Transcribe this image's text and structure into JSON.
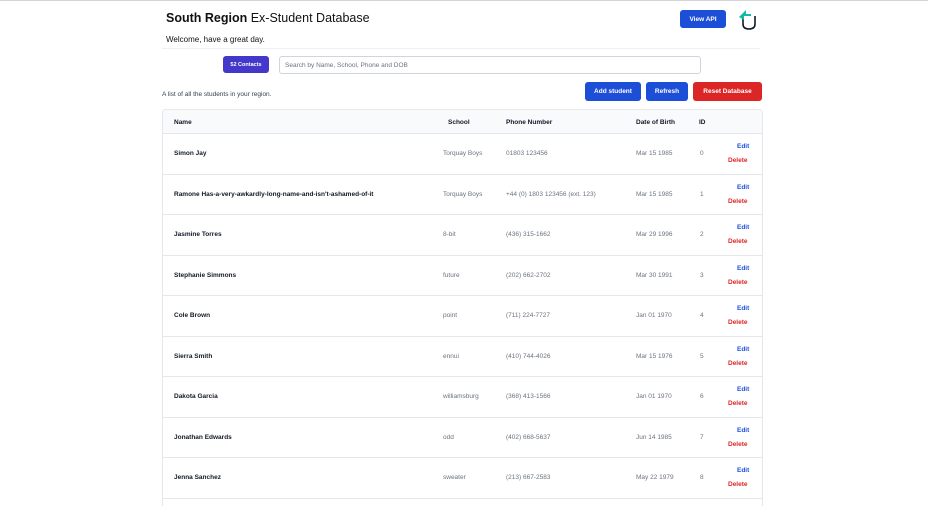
{
  "header": {
    "title_bold": "South Region",
    "title_rest": " Ex-Student Database",
    "welcome": "Welcome, have a great day.",
    "api_button": "View API",
    "logo_icon": "shield-upload-icon"
  },
  "toolbar": {
    "contacts_count": "52 Contacts",
    "search_placeholder": "Search by Name, School, Phone and DOB",
    "search_value": "",
    "caption": "A list of all the students in your region.",
    "add_label": "Add student",
    "refresh_label": "Refresh",
    "reset_label": "Reset Database"
  },
  "colors": {
    "primary": "#1d4ed8",
    "badge": "#4338ca",
    "danger": "#dc2626"
  },
  "table": {
    "columns": [
      "Name",
      "School",
      "Phone Number",
      "Date of Birth",
      "ID"
    ],
    "edit_label": "Edit",
    "delete_label": "Delete",
    "rows": [
      {
        "name": "Simon Jay",
        "school": "Torquay Boys",
        "phone": "01803 123456",
        "dob": "Mar 15 1985",
        "id": "0"
      },
      {
        "name": "Ramone Has-a-very-awkardly-long-name-and-isn't-ashamed-of-it",
        "school": "Torquay Boys",
        "phone": "+44 (0) 1803 123456 (ext. 123)",
        "dob": "Mar 15 1985",
        "id": "1"
      },
      {
        "name": "Jasmine Torres",
        "school": "8-bit",
        "phone": "(436) 315-1662",
        "dob": "Mar 29 1996",
        "id": "2"
      },
      {
        "name": "Stephanie Simmons",
        "school": "future",
        "phone": "(202) 662-2702",
        "dob": "Mar 30 1991",
        "id": "3"
      },
      {
        "name": "Cole Brown",
        "school": "point",
        "phone": "(711) 224-7727",
        "dob": "Jan 01 1970",
        "id": "4"
      },
      {
        "name": "Sierra Smith",
        "school": "ennui",
        "phone": "(410) 744-4026",
        "dob": "Mar 15 1976",
        "id": "5"
      },
      {
        "name": "Dakota Garcia",
        "school": "williamsburg",
        "phone": "(368) 413-1566",
        "dob": "Jan 01 1970",
        "id": "6"
      },
      {
        "name": "Jonathan Edwards",
        "school": "odd",
        "phone": "(402) 668-5637",
        "dob": "Jun 14 1985",
        "id": "7"
      },
      {
        "name": "Jenna Sanchez",
        "school": "sweater",
        "phone": "(213) 667-2583",
        "dob": "May 22 1979",
        "id": "8"
      }
    ]
  }
}
